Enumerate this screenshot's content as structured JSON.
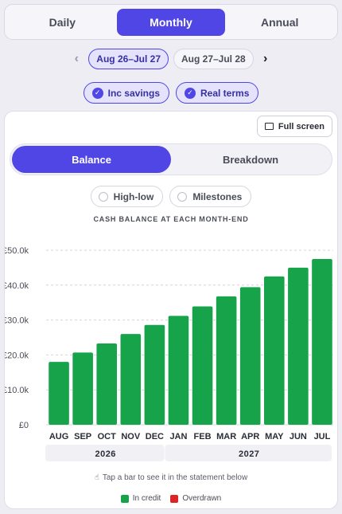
{
  "period_tabs": [
    {
      "label": "Daily",
      "active": false
    },
    {
      "label": "Monthly",
      "active": true
    },
    {
      "label": "Annual",
      "active": false
    }
  ],
  "range": {
    "prev_icon": "chevron-left-icon",
    "next_icon": "chevron-right-icon",
    "options": [
      {
        "label": "Aug 26–Jul 27",
        "active": true
      },
      {
        "label": "Aug 27–Jul 28",
        "active": false
      }
    ]
  },
  "toggles": [
    {
      "label": "Inc savings",
      "checked": true
    },
    {
      "label": "Real terms",
      "checked": true
    }
  ],
  "card": {
    "fullscreen_label": "Full screen",
    "tabs": [
      {
        "label": "Balance",
        "active": true
      },
      {
        "label": "Breakdown",
        "active": false
      }
    ],
    "options": [
      {
        "label": "High-low",
        "checked": false
      },
      {
        "label": "Milestones",
        "checked": false
      }
    ],
    "hint": "Tap a bar to see it in the statement below",
    "hint_icon": "tap-hand-icon"
  },
  "colors": {
    "accent": "#4f46e5",
    "in_credit": "#16a34a",
    "overdrawn": "#dc2626"
  },
  "chart_data": {
    "type": "bar",
    "title": "CASH BALANCE AT EACH MONTH-END",
    "categories": [
      "AUG",
      "SEP",
      "OCT",
      "NOV",
      "DEC",
      "JAN",
      "FEB",
      "MAR",
      "APR",
      "MAY",
      "JUN",
      "JUL"
    ],
    "values": [
      18000,
      20700,
      23300,
      26000,
      28600,
      31200,
      33900,
      36800,
      39400,
      42500,
      45000,
      47500
    ],
    "ylim": [
      0,
      50000
    ],
    "yticks": [
      "£0",
      "£10.0k",
      "£20.0k",
      "£30.0k",
      "£40.0k",
      "£50.0k"
    ],
    "grid": true,
    "years": [
      {
        "label": "2026",
        "months": 5
      },
      {
        "label": "2027",
        "months": 7
      }
    ],
    "legend": [
      {
        "label": "In credit",
        "color": "#16a34a"
      },
      {
        "label": "Overdrawn",
        "color": "#dc2626"
      }
    ],
    "legend_placement": "bottom"
  }
}
